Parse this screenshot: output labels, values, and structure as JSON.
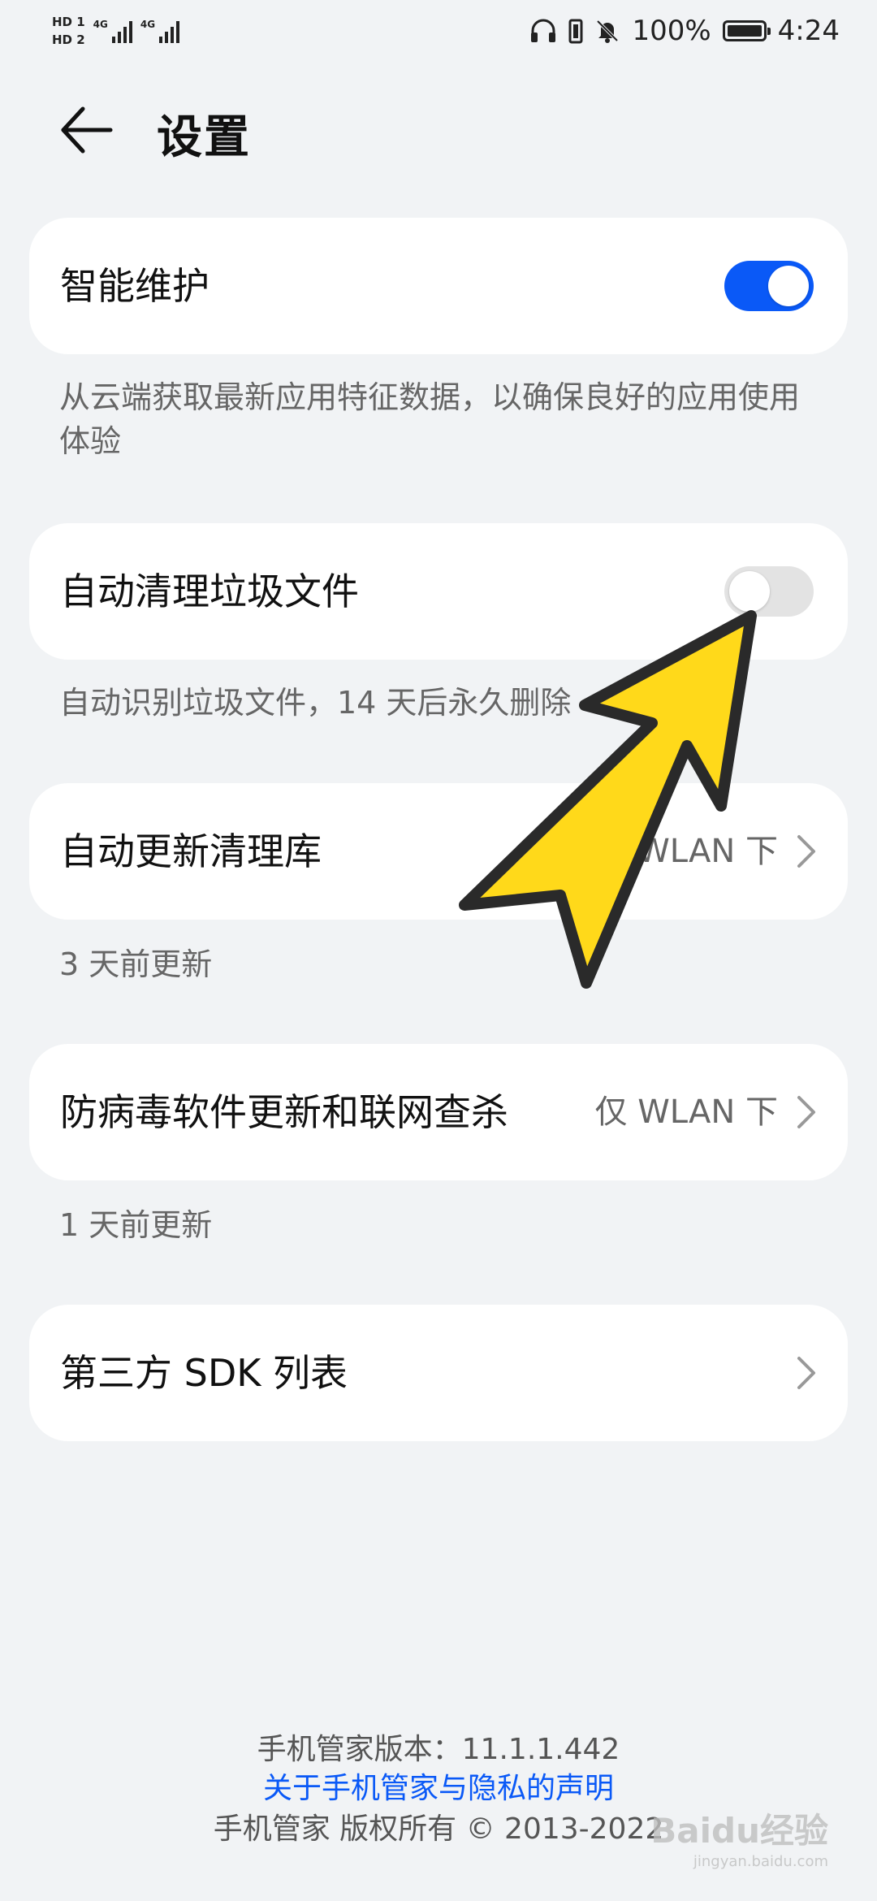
{
  "status_bar": {
    "sim1": "HD 1",
    "sim2": "HD 2",
    "net1": "4G",
    "net2": "4G",
    "battery": "100%",
    "time": "4:24"
  },
  "header": {
    "title": "设置"
  },
  "settings": [
    {
      "label": "智能维护",
      "toggle": "on",
      "description": "从云端获取最新应用特征数据，以确保良好的应用使用体验"
    },
    {
      "label": "自动清理垃圾文件",
      "toggle": "off",
      "description": "自动识别垃圾文件，14 天后永久删除"
    },
    {
      "label": "自动更新清理库",
      "value": "仅 WLAN 下",
      "description": "3 天前更新"
    },
    {
      "label": "防病毒软件更新和联网查杀",
      "value": "仅 WLAN 下",
      "description": "1 天前更新"
    },
    {
      "label": "第三方 SDK 列表"
    }
  ],
  "footer": {
    "version": "手机管家版本：11.1.1.442",
    "privacy_link": "关于手机管家与隐私的声明",
    "copyright": "手机管家 版权所有 © 2013-2022"
  },
  "watermark": {
    "brand": "Baidu经验",
    "url": "jingyan.baidu.com"
  },
  "colors": {
    "accent": "#0a59f7",
    "background": "#f1f3f5",
    "arrow_fill": "#ffd91a"
  }
}
